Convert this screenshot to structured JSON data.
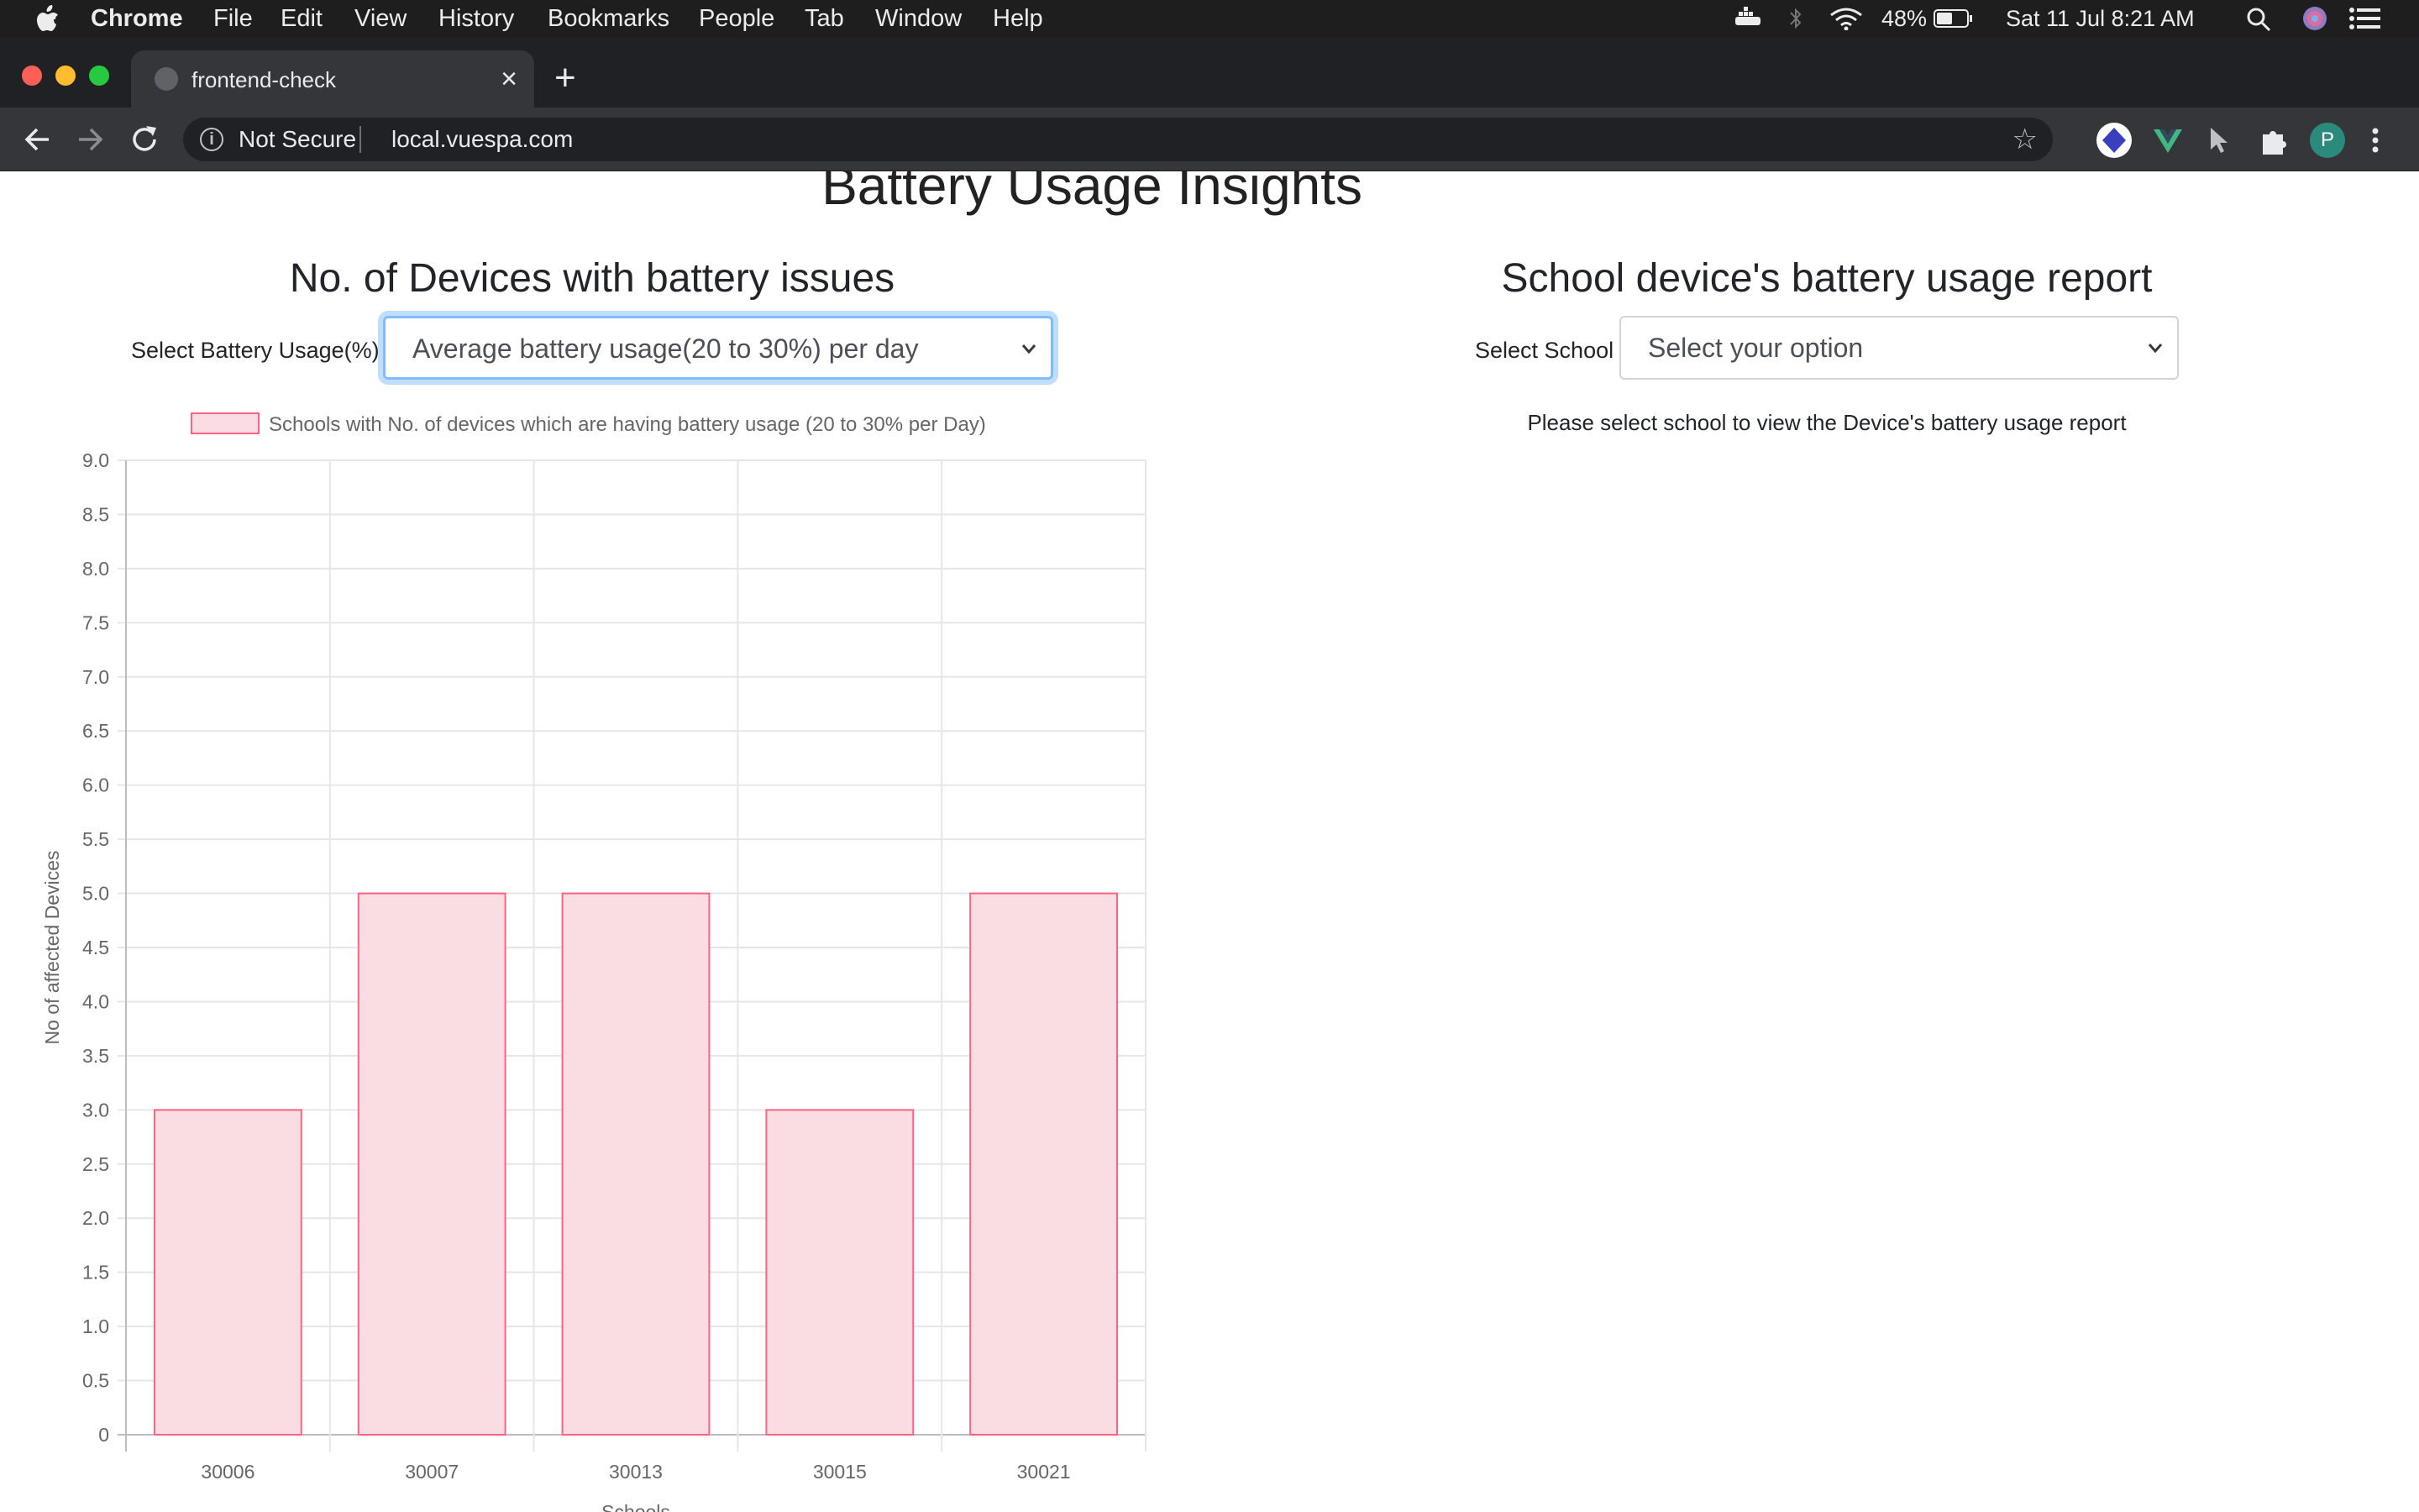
{
  "menubar": {
    "app_name": "Chrome",
    "menus": [
      "File",
      "Edit",
      "View",
      "History",
      "Bookmarks",
      "People",
      "Tab",
      "Window",
      "Help"
    ],
    "battery_percent": "48%",
    "datetime": "Sat 11 Jul  8:21 AM"
  },
  "browser": {
    "tab_title": "frontend-check",
    "security_label": "Not Secure",
    "url": "local.vuespa.com",
    "profile_initial": "P"
  },
  "page": {
    "title": "Battery Usage Insights",
    "left": {
      "heading": "No. of Devices with battery issues",
      "select_label": "Select Battery Usage(%)",
      "select_value": "Average battery usage(20 to 30%) per day"
    },
    "right": {
      "heading": "School device's battery usage report",
      "select_label": "Select School",
      "select_value": "Select your option",
      "message": "Please select school to view the Device's battery usage report"
    }
  },
  "chart_data": {
    "type": "bar",
    "categories": [
      "30006",
      "30007",
      "30013",
      "30015",
      "30021"
    ],
    "series": [
      {
        "name": "Schools with No. of devices which are having battery usage (20 to 30% per Day)",
        "values": [
          3,
          5,
          5,
          3,
          5
        ]
      }
    ],
    "xlabel": "Schools",
    "ylabel": "No of affected Devices",
    "ylim": [
      0,
      9
    ],
    "ytick_step": 0.5,
    "grid": true,
    "legend": "top",
    "colors": {
      "bar_fill": "#fadde3",
      "bar_border": "#ff6384",
      "grid": "#e6e6e6"
    }
  }
}
